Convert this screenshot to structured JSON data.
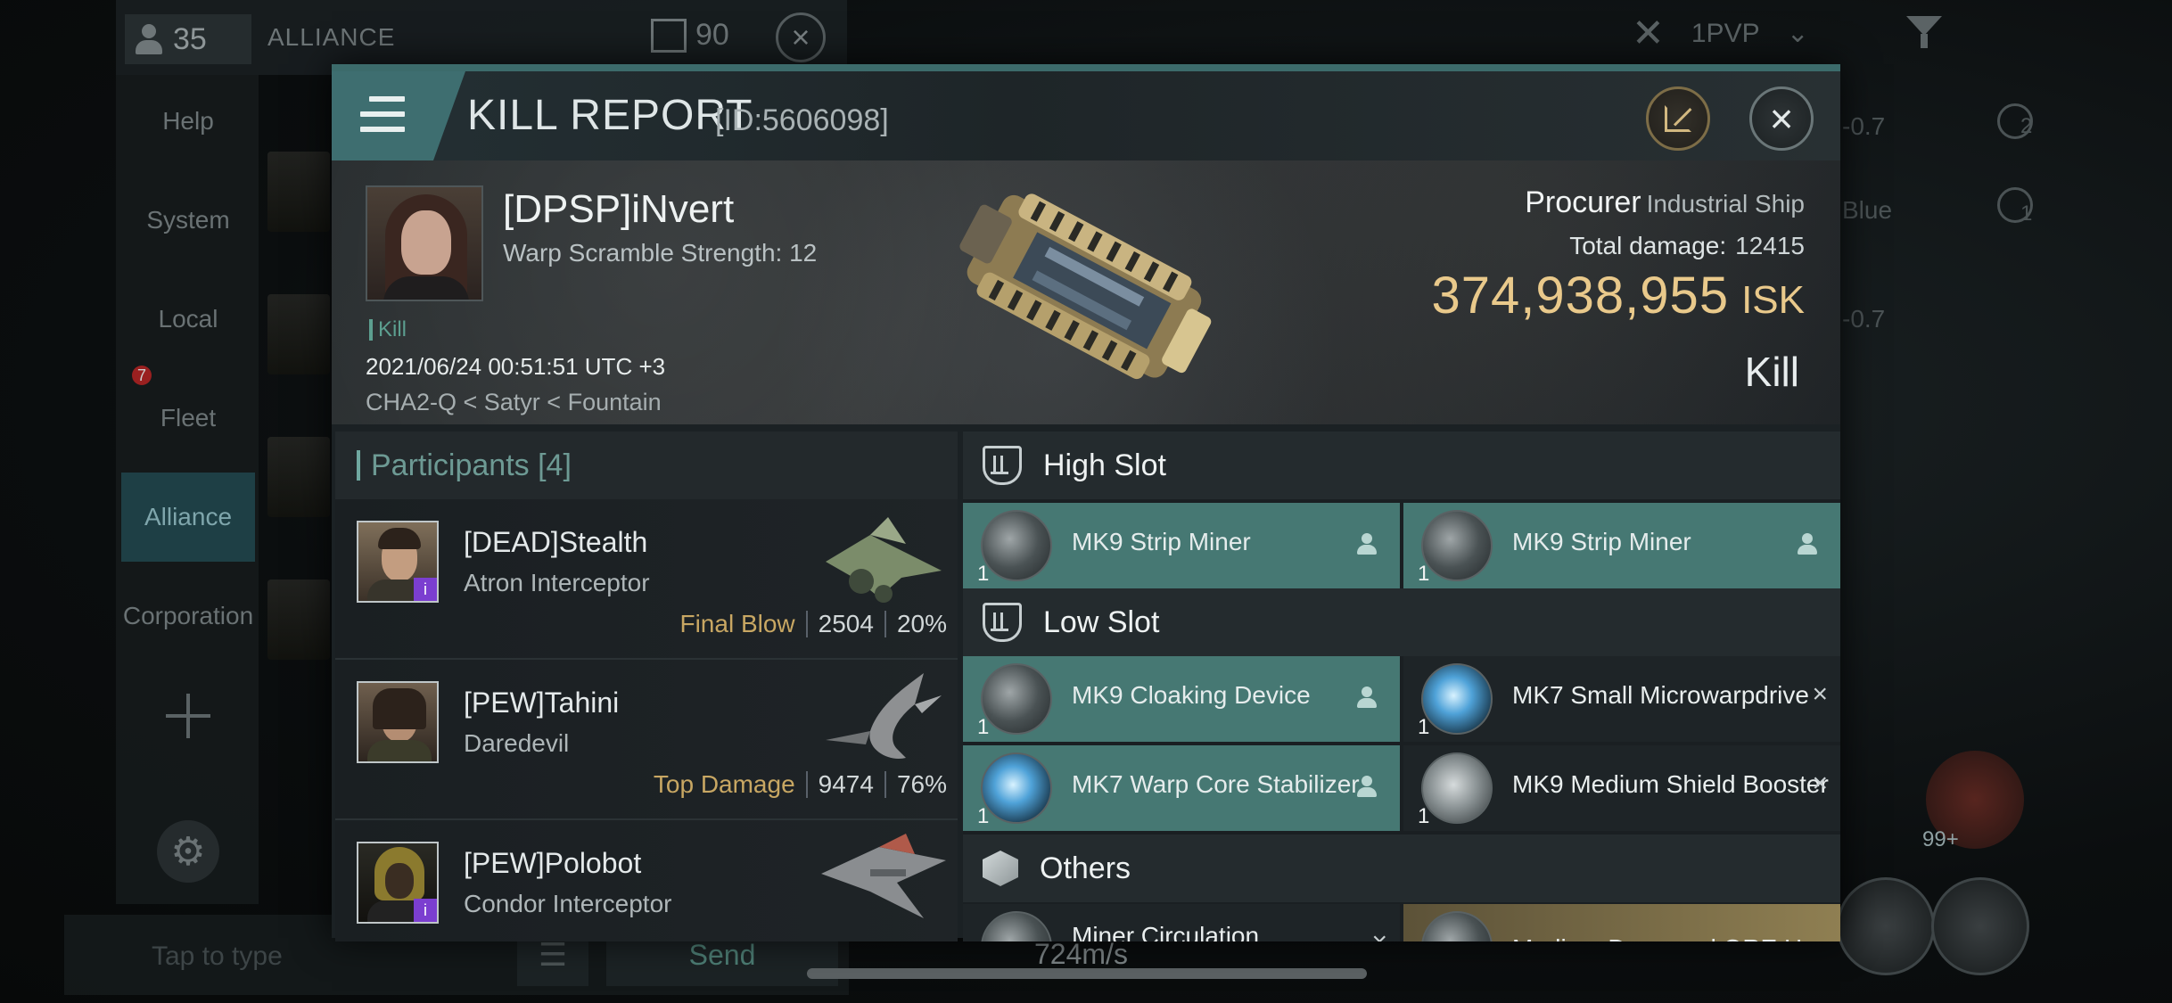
{
  "background": {
    "player_count": "35",
    "alliance_label": "ALLIANCE",
    "mail_count": "90",
    "pvp_mode": "1PVP",
    "sidebar": [
      {
        "label": "Help"
      },
      {
        "label": "System"
      },
      {
        "label": "Local"
      },
      {
        "label": "Fleet"
      },
      {
        "label": "Alliance"
      },
      {
        "label": "Corporation"
      }
    ],
    "fleet_badge": "7",
    "send_label": "Send",
    "input_placeholder": "Tap to type",
    "speed": "724m/s",
    "right_values": [
      "-0.7",
      "Blue",
      "-0.7"
    ],
    "right_counts": [
      "2",
      "1"
    ],
    "bottom_badge": "99+"
  },
  "header": {
    "title": "KILL REPORT",
    "id_label": "[ID:5606098]"
  },
  "summary": {
    "victim_name": "[DPSP]iNvert",
    "warp_scramble": "Warp Scramble Strength: 12",
    "tag": "Kill",
    "datetime": "2021/06/24 00:51:51 UTC +3",
    "location": "CHA2-Q < Satyr < Fountain",
    "ship_name": "Procurer",
    "ship_class": "Industrial Ship",
    "total_damage_label": "Total damage:",
    "total_damage": "12415",
    "isk_value": "374,938,955",
    "isk_unit": "ISK",
    "result": "Kill"
  },
  "participants": {
    "header": "Participants [4]",
    "items": [
      {
        "name": "[DEAD]Stealth",
        "ship": "Atron Interceptor",
        "tag": "Final Blow",
        "damage": "2504",
        "percent": "20%",
        "badge": "i"
      },
      {
        "name": "[PEW]Tahini",
        "ship": "Daredevil",
        "tag": "Top Damage",
        "damage": "9474",
        "percent": "76%",
        "badge": ""
      },
      {
        "name": "[PEW]Polobot",
        "ship": "Condor Interceptor",
        "tag": "",
        "damage": "",
        "percent": "",
        "badge": "i"
      }
    ]
  },
  "modules": {
    "high_slot": {
      "title": "High Slot",
      "items": [
        {
          "name": "MK9 Strip Miner",
          "qty": "1",
          "state": "fitted"
        },
        {
          "name": "MK9 Strip Miner",
          "qty": "1",
          "state": "fitted"
        }
      ]
    },
    "low_slot": {
      "title": "Low Slot",
      "items": [
        {
          "name": "MK9 Cloaking Device",
          "qty": "1",
          "state": "fitted"
        },
        {
          "name": "MK7 Small Microwarpdrive",
          "qty": "1",
          "state": "destroyed"
        },
        {
          "name": "MK7 Warp Core Stabilizer",
          "qty": "1",
          "state": "fitted"
        },
        {
          "name": "MK9 Medium Shield Booster",
          "qty": "1",
          "state": "destroyed"
        }
      ]
    },
    "others": {
      "title": "Others",
      "items": [
        {
          "name": "Miner Circulation...",
          "state": "destroyed"
        },
        {
          "name": "Medium Damaged ORE Hu",
          "state": "gold"
        }
      ]
    }
  },
  "colors": {
    "accent": "#467873",
    "isk": "#e9c98b",
    "tag_gold": "#c8a763"
  }
}
